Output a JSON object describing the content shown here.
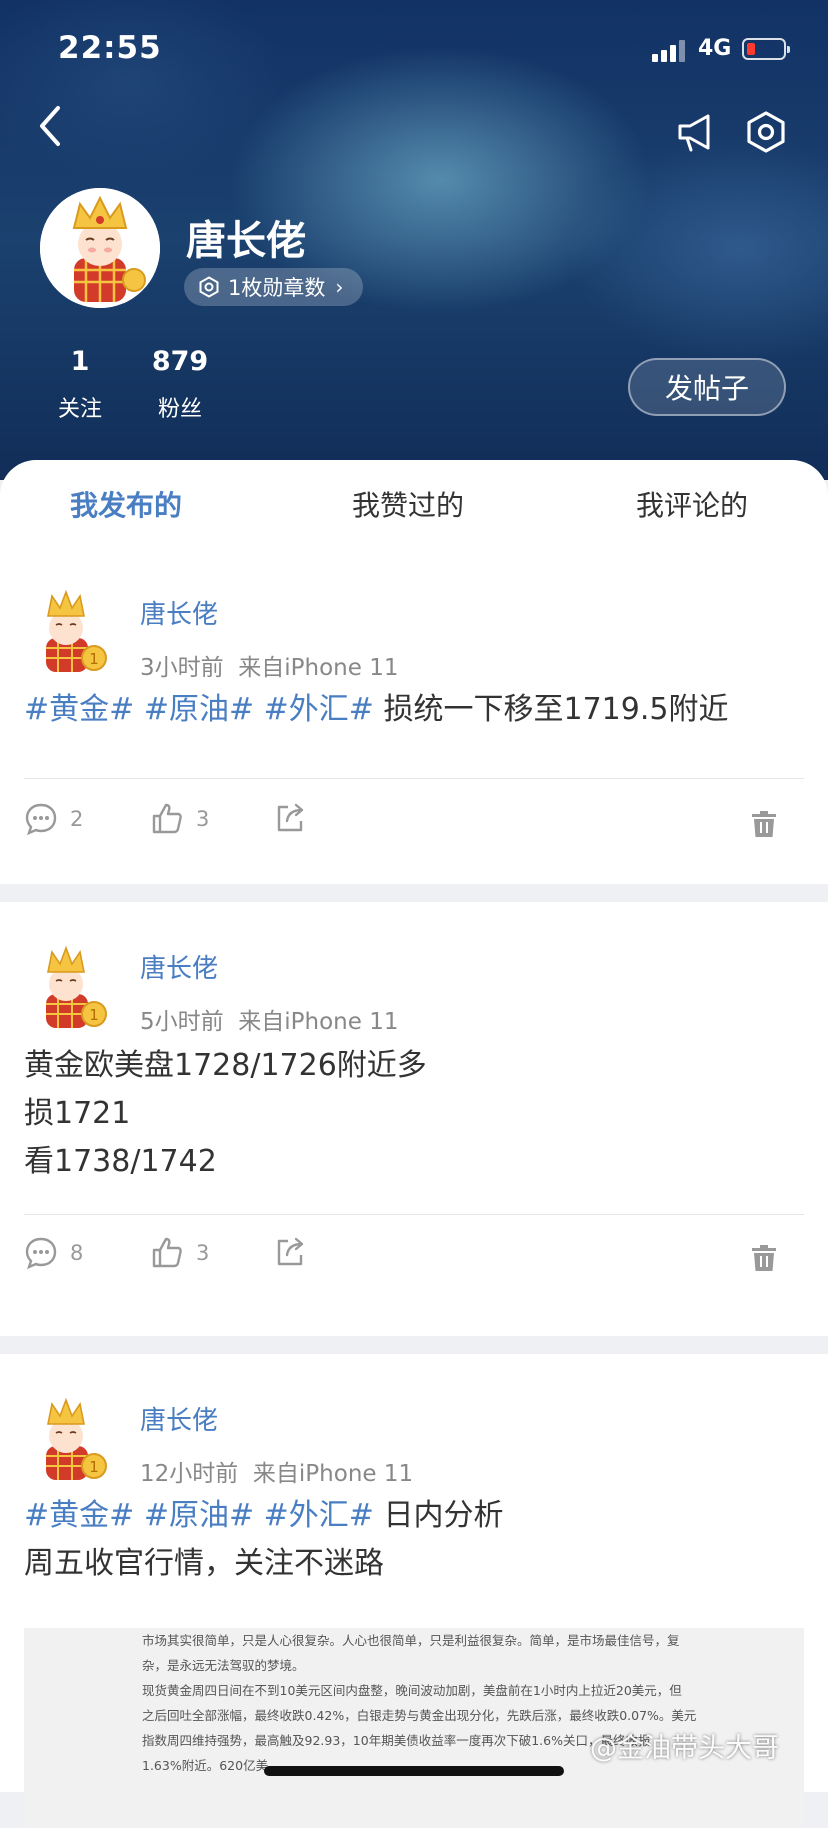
{
  "status_bar": {
    "time": "22:55",
    "network": "4G"
  },
  "profile": {
    "name": "唐长佬",
    "badge_label": "1枚勋章数",
    "following_count": "1",
    "following_label": "关注",
    "followers_count": "879",
    "followers_label": "粉丝",
    "post_button": "发帖子"
  },
  "tabs": [
    {
      "label": "我发布的",
      "active": true
    },
    {
      "label": "我赞过的",
      "active": false
    },
    {
      "label": "我评论的",
      "active": false
    }
  ],
  "posts": [
    {
      "author": "唐长佬",
      "time_ago": "3小时前",
      "source": "来自iPhone 11",
      "tags": [
        "#黄金#",
        "#原油#",
        "#外汇#"
      ],
      "lines": [
        "损统一下移至1719.5附近"
      ],
      "comments": "2",
      "likes": "3"
    },
    {
      "author": "唐长佬",
      "time_ago": "5小时前",
      "source": "来自iPhone 11",
      "lines": [
        "黄金欧美盘1728/1726附近多",
        "损1721",
        "看1738/1742"
      ],
      "comments": "8",
      "likes": "3"
    },
    {
      "author": "唐长佬",
      "time_ago": "12小时前",
      "source": "来自iPhone 11",
      "tags": [
        "#黄金#",
        "#原油#",
        "#外汇#"
      ],
      "lines": [
        "日内分析",
        "周五收官行情，关注不迷路"
      ],
      "image_text": [
        "市场其实很简单，只是人心很复杂。人心也很简单，只是利益很复杂。简单，是市场最佳信号，复",
        "杂，是永远无法驾驭的梦境。",
        "",
        "现货黄金周四日间在不到10美元区间内盘整，晚间波动加剧，美盘前在1小时内上拉近20美元，但",
        "之后回吐全部涨幅，最终收跌0.42%，白银走势与黄金出现分化，先跌后涨，最终收跌0.07%。美元",
        "指数周四维持强势，最高触及92.93，10年期美债收益率一度再次下破1.6%关口，最终收报",
        "1.63%附近。620亿美"
      ]
    }
  ],
  "watermark": "@金油带头大哥",
  "colors": {
    "accent": "#4a7ec3",
    "header_bg": "#123265",
    "battery_low": "#ff3b30"
  },
  "icons": [
    "back-icon",
    "megaphone-icon",
    "settings-icon",
    "medal-icon",
    "comment-icon",
    "like-icon",
    "share-icon",
    "trash-icon"
  ]
}
